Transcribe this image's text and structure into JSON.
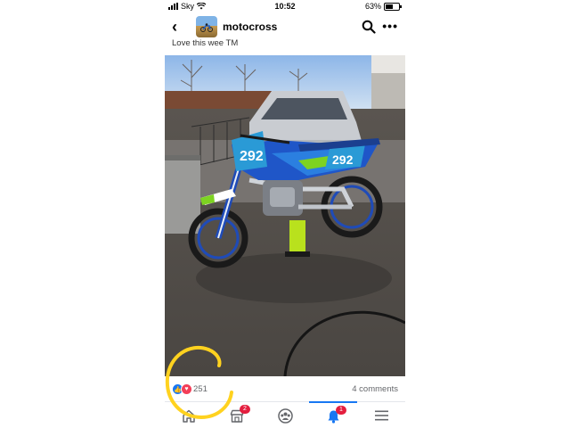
{
  "status_bar": {
    "carrier": "Sky",
    "time": "10:52",
    "battery": "63%",
    "battery_level": 0.63
  },
  "header": {
    "back_icon": "chevron-left-icon",
    "group_name": "motocross",
    "search_icon": "search-icon",
    "more_icon": "ellipsis-icon"
  },
  "post": {
    "caption": "Love this wee TM",
    "image_alt": "photo-motocross-bike",
    "bike_number": "292",
    "reaction_count": "251",
    "comments": "4 comments",
    "reaction_icons": [
      "like-icon",
      "love-icon"
    ]
  },
  "nav": {
    "items": [
      {
        "icon": "home-icon",
        "badge": ""
      },
      {
        "icon": "marketplace-icon",
        "badge": "2"
      },
      {
        "icon": "groups-icon",
        "badge": ""
      },
      {
        "icon": "bell-icon",
        "badge": "1"
      },
      {
        "icon": "menu-icon",
        "badge": ""
      }
    ]
  },
  "colors": {
    "accent": "#1877f2",
    "badge": "#e41e3f",
    "annotation": "#ffd21f"
  }
}
